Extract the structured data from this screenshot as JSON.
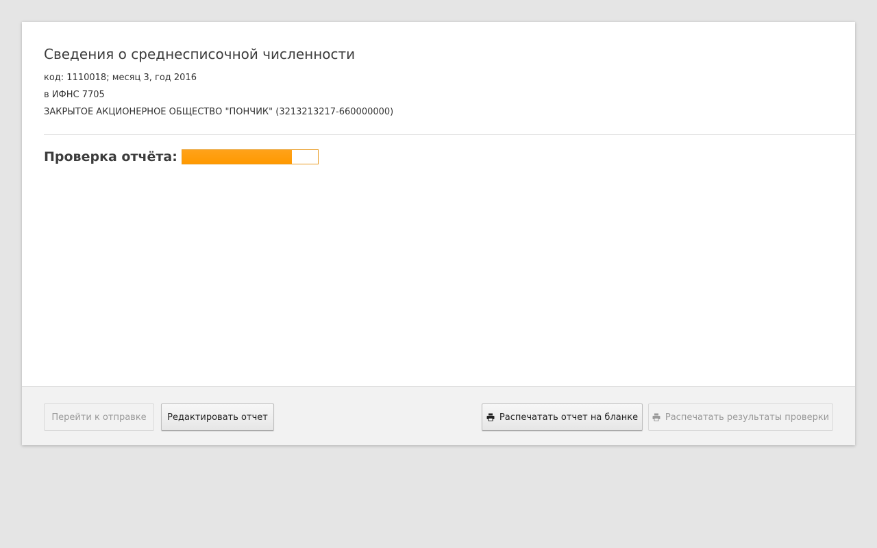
{
  "report": {
    "title": "Сведения о среднесписочной численности",
    "code_line": "код: 1110018; месяц 3, год 2016",
    "inspection_line": "в ИФНС 7705",
    "organization_line": "ЗАКРЫТОЕ АКЦИОНЕРНОЕ ОБЩЕСТВО \"ПОНЧИК\" (3213213217-660000000)"
  },
  "check": {
    "label": "Проверка отчёта:",
    "progress_percent": 81,
    "progress_color": "#ff9900"
  },
  "footer": {
    "send_label": "Перейти к отправке",
    "send_enabled": false,
    "edit_label": "Редактировать отчет",
    "edit_enabled": true,
    "print_blank_label": "Распечатать отчет на бланке",
    "print_blank_icon": "printer-icon",
    "print_blank_enabled": true,
    "print_results_label": "Распечатать результаты проверки",
    "print_results_icon": "printer-icon",
    "print_results_enabled": false
  }
}
